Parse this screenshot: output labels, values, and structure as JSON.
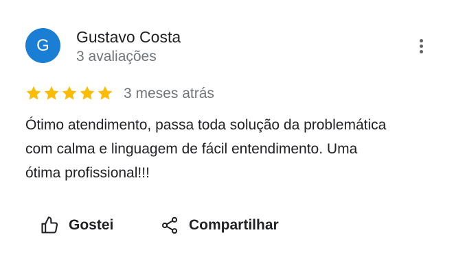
{
  "review": {
    "avatar_initial": "G",
    "reviewer_name": "Gustavo Costa",
    "review_count": "3 avaliações",
    "rating": 5,
    "rating_max": 5,
    "date": "3 meses atrás",
    "text": "Ótimo atendimento, passa toda solução da problemática com calma e linguagem de fácil entendimento. Uma ótima profissional!!!"
  },
  "actions": {
    "like_label": "Gostei",
    "share_label": "Compartilhar"
  },
  "colors": {
    "avatar": "#1a7fd4",
    "star": "#fbbc04",
    "secondary_text": "#70757a"
  },
  "icons": {
    "more": "more-vertical-icon",
    "star": "star-icon",
    "like": "thumbs-up-icon",
    "share": "share-icon"
  }
}
